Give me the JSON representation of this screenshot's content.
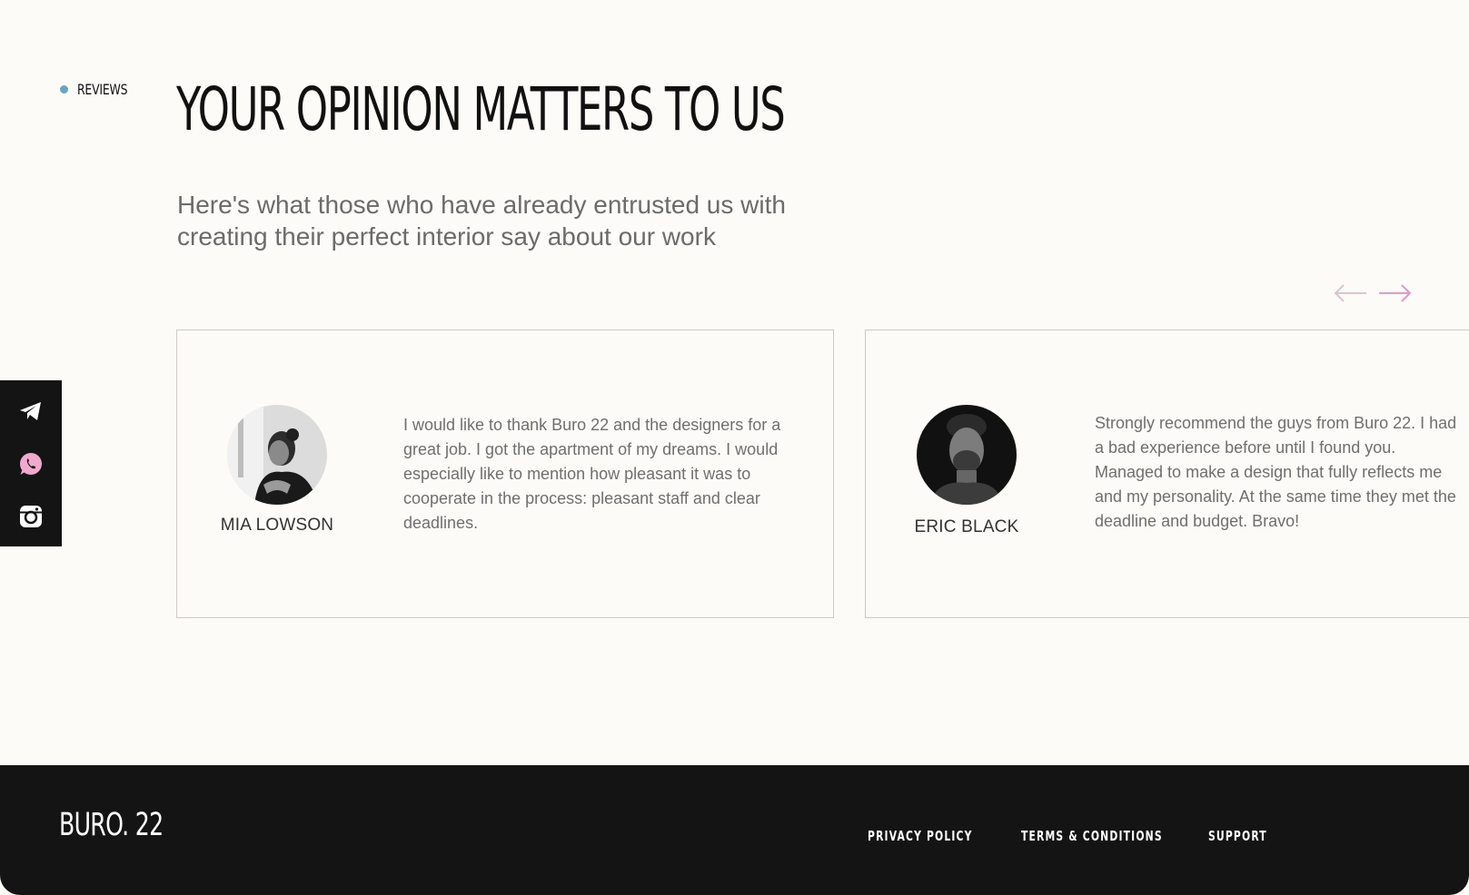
{
  "section": {
    "tag": "REVIEWS",
    "tag_dot_color": "#6aa5bf"
  },
  "header": {
    "title": "YOUR OPINION MATTERS TO US",
    "subtitle": "Here's what those who have already entrusted us with creating their perfect interior say about our work"
  },
  "carousel": {
    "prev_icon": "arrow-left-icon",
    "next_icon": "arrow-right-icon",
    "prev_color": "#ddc2d4",
    "next_color": "#d99ccc"
  },
  "reviews": [
    {
      "name": "MIA LOWSON",
      "text": "I would like to thank Buro 22 and the designers for a great job. I got the apartment of my dreams. I would especially like to mention how pleasant it was to cooperate in the process: pleasant staff and clear deadlines."
    },
    {
      "name": "ERIC BLACK",
      "lines": [
        "Strongly recommend the guys from Buro 22. I had",
        "a bad experience before until I found you.",
        "Managed to make a design that fully reflects me",
        "and my personality. At the same time they met the",
        "deadline and budget. Bravo!"
      ]
    }
  ],
  "social": [
    {
      "icon": "telegram-icon",
      "color": "#ffffff"
    },
    {
      "icon": "whatsapp-icon",
      "color": "#f2a9cf"
    },
    {
      "icon": "instagram-icon",
      "color": "#ffffff"
    }
  ],
  "footer": {
    "logo": "BURO. 22",
    "links": {
      "privacy": "PRIVACY POLICY",
      "terms": "TERMS & CONDITIONS",
      "support": "SUPPORT"
    }
  }
}
